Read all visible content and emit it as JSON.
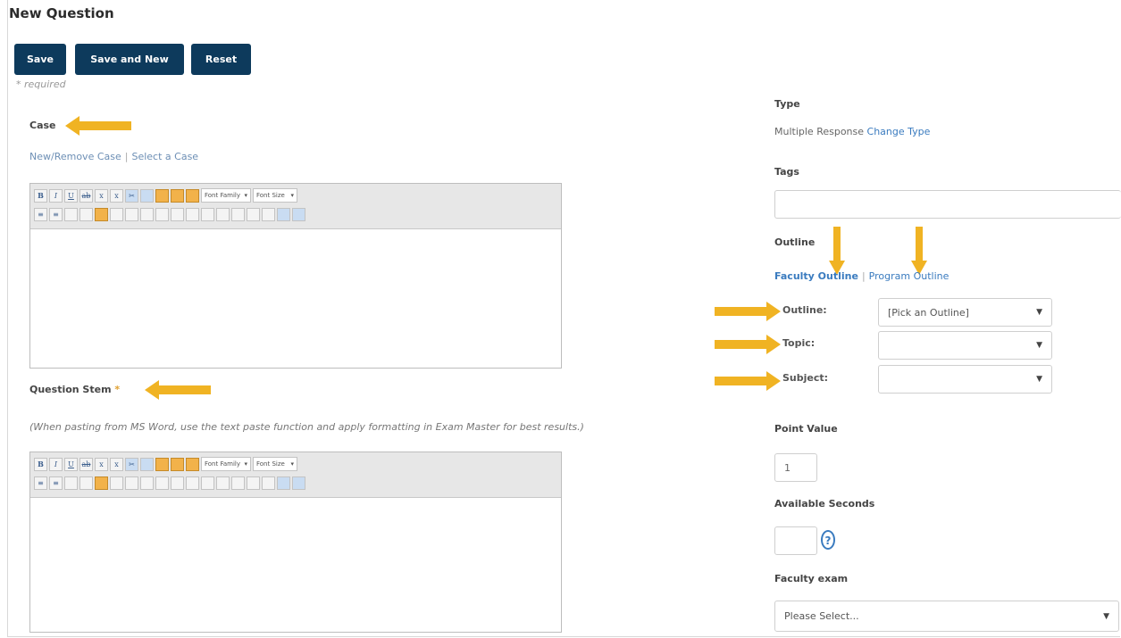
{
  "page": {
    "title": "New Question"
  },
  "toolbar": {
    "save": "Save",
    "save_new": "Save and New",
    "reset": "Reset"
  },
  "required_note": "* required",
  "case": {
    "label": "Case",
    "new_remove": "New/Remove Case",
    "separator": "|",
    "select": "Select a Case"
  },
  "editor": {
    "bold": "B",
    "italic": "I",
    "underline": "U",
    "strike": "ab",
    "subscript": "x",
    "superscript": "x",
    "font_family": "Font Family",
    "font_size": "Font Size"
  },
  "question_stem": {
    "label": "Question Stem",
    "required_mark": "*",
    "help": "(When pasting from MS Word, use the text paste function and apply formatting in Exam Master for best results.)"
  },
  "type": {
    "label": "Type",
    "value": "Multiple Response",
    "change": "Change Type"
  },
  "tags": {
    "label": "Tags",
    "value": ""
  },
  "outline": {
    "label": "Outline",
    "faculty_link": "Faculty Outline",
    "separator": "|",
    "program_link": "Program Outline",
    "outline_label": "Outline:",
    "outline_value": "[Pick an Outline]",
    "topic_label": "Topic:",
    "topic_value": "",
    "subject_label": "Subject:",
    "subject_value": ""
  },
  "point_value": {
    "label": "Point Value",
    "value": "1"
  },
  "available_seconds": {
    "label": "Available Seconds",
    "value": "",
    "help_icon": "?"
  },
  "faculty_exam": {
    "label": "Faculty exam",
    "value": "Please Select..."
  },
  "icons": {
    "arrow": "annotation-arrow-icon",
    "caret": "chevron-down-icon",
    "help": "question-circle-icon"
  },
  "colors": {
    "button": "#0d3a5c",
    "link": "#3a7bbf",
    "arrow": "#f0b323"
  }
}
